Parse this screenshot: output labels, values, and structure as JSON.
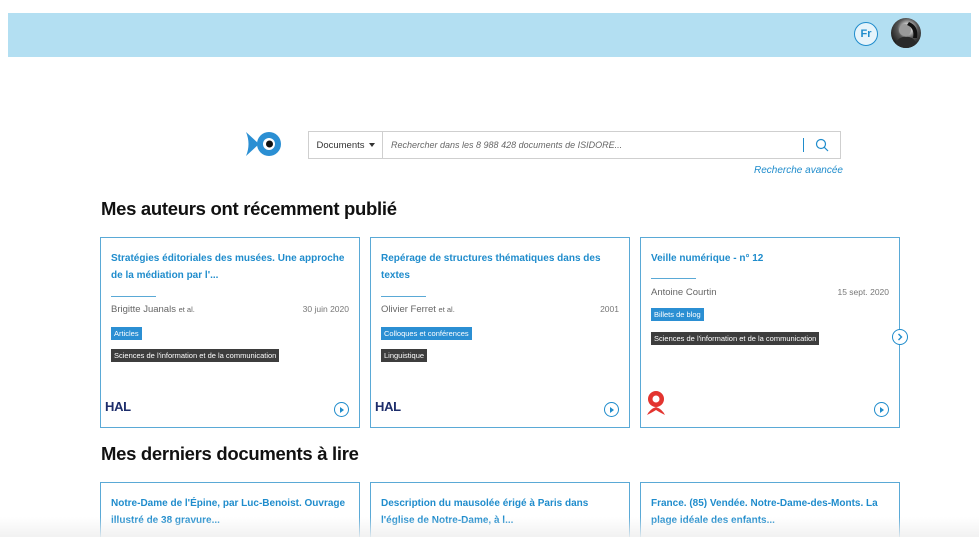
{
  "header": {
    "lang_label": "Fr"
  },
  "search": {
    "scope_label": "Documents",
    "placeholder": "Rechercher dans les 8 988 428 documents de ISIDORE...",
    "advanced_label": "Recherche avancée"
  },
  "section_authors": {
    "title": "Mes auteurs ont récemment publié",
    "cards": [
      {
        "title": "Stratégies éditoriales des musées. Une approche de la médiation par l'...",
        "author": "Brigitte Juanals",
        "etal": "et al.",
        "date": "30 juin 2020",
        "type_tag": "Articles",
        "discipline_tag": "Sciences de l'information et de la communication",
        "source": "HAL"
      },
      {
        "title": "Repérage de structures thématiques dans des textes",
        "author": "Olivier Ferret",
        "etal": "et al.",
        "date": "2001",
        "type_tag": "Colloques et conférences",
        "discipline_tag": "Linguistique",
        "source": "HAL"
      },
      {
        "title": "Veille numérique - n° 12",
        "author": "Antoine Courtin",
        "etal": "",
        "date": "15 sept. 2020",
        "type_tag": "Billets de blog",
        "discipline_tag": "Sciences de l'information et de la communication",
        "source": ""
      }
    ]
  },
  "section_reading": {
    "title": "Mes derniers documents à lire",
    "cards": [
      {
        "title": "Notre-Dame de l'Épine, par Luc-Benoist. Ouvrage illustré de 38 gravure..."
      },
      {
        "title": "Description du mausolée érigé à Paris dans l'église de Notre-Dame, à l..."
      },
      {
        "title": "France. (85) Vendée. Notre-Dame-des-Monts. La plage idéale des enfants..."
      }
    ]
  },
  "colors": {
    "topbar": "#b3dff2",
    "accent": "#1f8ccc",
    "tag_blue": "#2b8fd3",
    "tag_dark": "#3d3d3d"
  }
}
